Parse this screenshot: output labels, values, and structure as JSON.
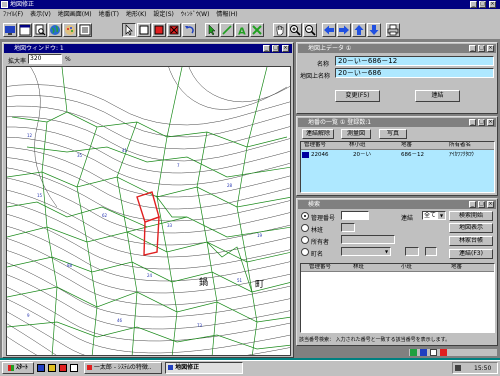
{
  "app": {
    "title": "地図修正"
  },
  "menu": [
    "ﾌｧｲﾙ(F)",
    "表示(V)",
    "地図画面(M)",
    "地番(T)",
    "地形(K)",
    "設定(S)",
    "ｳｨﾝﾄﾞｳ(W)",
    "情報(H)"
  ],
  "map_window": {
    "title": "地図ウィンドウ: 1",
    "zoom_label": "拡大率",
    "zoom_value": "320",
    "zoom_unit": "%",
    "map_label": "町"
  },
  "info_window": {
    "title": "地図上データ  ①",
    "name_label": "名称",
    "name_value": "20－い－686－12",
    "map_name_label": "地図上名称",
    "map_name_value": "20－い－686",
    "change_button": "変更(F5)",
    "link_button": "連結"
  },
  "list_window": {
    "title": "地番の一覧  ①  登録数:1",
    "buttons": [
      "連結解除",
      "測量図",
      "写真"
    ],
    "headers": [
      "管理番号",
      "林小班",
      "地番",
      "所有者名"
    ],
    "rows": [
      [
        "22046",
        "20－い",
        "686－12",
        "ｱｲｶﾜﾌｸﾀﾛｳ"
      ]
    ]
  },
  "search_window": {
    "title": "検索",
    "options": [
      "管理番号",
      "林班",
      "所有者",
      "町名"
    ],
    "link_label": "連結",
    "link_value": "全て",
    "buttons": [
      "検索開始",
      "地図表示",
      "林家台帳",
      "連結(F3)"
    ],
    "headers": [
      "管理番号",
      "林班",
      "小班",
      "地番"
    ]
  },
  "status": {
    "text": "該当番号検索： 入力された番号と一致する該当番号を表示します。"
  },
  "taskbar": {
    "start": "ｽﾀｰﾄ",
    "tasks": [
      "一太郎 - ｼｽﾃﾑの特徴..",
      "地図修正"
    ],
    "clock": "15:50"
  }
}
